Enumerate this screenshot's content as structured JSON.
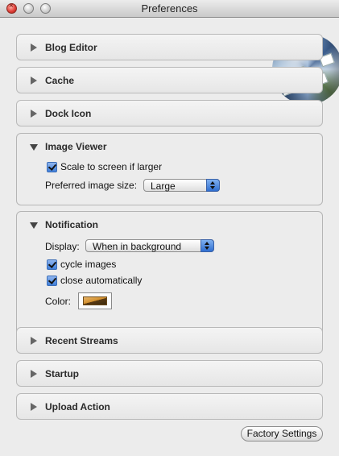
{
  "window": {
    "title": "Preferences"
  },
  "sections": {
    "blog_editor": {
      "label": "Blog Editor"
    },
    "cache": {
      "label": "Cache"
    },
    "dock_icon": {
      "label": "Dock Icon"
    },
    "image_viewer": {
      "label": "Image Viewer",
      "scale_to_screen": {
        "label": "Scale to screen if larger",
        "checked": true
      },
      "preferred_size": {
        "label": "Preferred image size:",
        "value": "Large"
      }
    },
    "notification": {
      "label": "Notification",
      "display": {
        "label": "Display:",
        "value": "When in background"
      },
      "cycle_images": {
        "label": "cycle images",
        "checked": true
      },
      "close_automatically": {
        "label": "close automatically",
        "checked": true
      },
      "color": {
        "label": "Color:"
      }
    },
    "recent_streams": {
      "label": "Recent Streams"
    },
    "startup": {
      "label": "Startup"
    },
    "upload_action": {
      "label": "Upload Action"
    }
  },
  "footer": {
    "factory_settings_label": "Factory Settings"
  }
}
